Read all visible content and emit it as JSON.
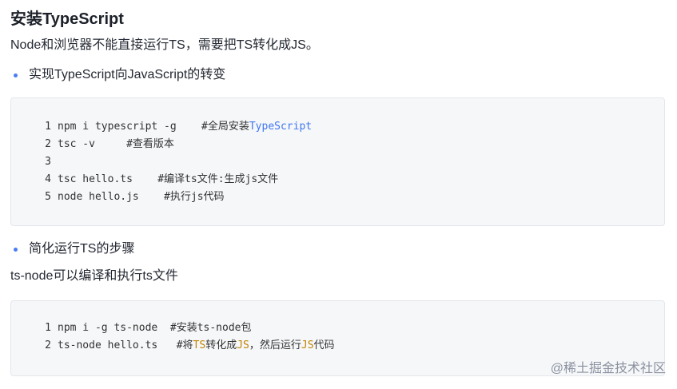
{
  "heading": "安装TypeScript",
  "intro": "Node和浏览器不能直接运行TS，需要把TS转化成JS。",
  "bullet1": "实现TypeScript向JavaScript的转变",
  "code1": {
    "lines": [
      {
        "num": "1",
        "text": "npm i typescript -g    #全局安装",
        "hl": "TypeScript"
      },
      {
        "num": "2",
        "text": "tsc -v     #查看版本"
      },
      {
        "num": "3",
        "text": ""
      },
      {
        "num": "4",
        "text": "tsc hello.ts    #编译ts文件:生成js文件"
      },
      {
        "num": "5",
        "text": "node hello.js    #执行js代码"
      }
    ]
  },
  "bullet2": "简化运行TS的步骤",
  "para2": "ts-node可以编译和执行ts文件",
  "code2": {
    "line1_num": "1",
    "line1": "npm i -g ts-node  #安装ts-node包",
    "line2_num": "2",
    "line2_a": "ts-node hello.ts   #将",
    "line2_ts": "TS",
    "line2_b": "转化成",
    "line2_js": "JS",
    "line2_c": "，然后运行",
    "line2_js2": "JS",
    "line2_d": "代码"
  },
  "brand": "@稀土掘金技术社区"
}
